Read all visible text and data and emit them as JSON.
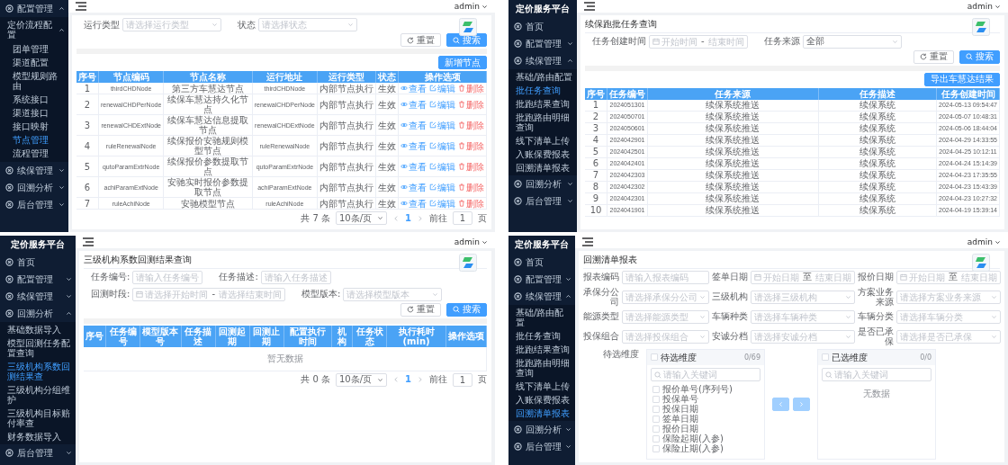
{
  "panels": [
    {
      "sidebar": {
        "items": [
          {
            "label": "配置管理",
            "selected": false,
            "expanded": true,
            "children": [
              {
                "label": "定价流程配置",
                "selected": false,
                "expanded": true,
                "children": [
                  {
                    "label": "团单管理",
                    "selected": false
                  },
                  {
                    "label": "渠道配置",
                    "selected": false
                  },
                  {
                    "label": "模型规则路由",
                    "selected": false
                  },
                  {
                    "label": "系统接口",
                    "selected": false
                  },
                  {
                    "label": "渠道接口",
                    "selected": false
                  },
                  {
                    "label": "接口映射",
                    "selected": false
                  },
                  {
                    "label": "节点管理",
                    "selected": true
                  },
                  {
                    "label": "流程管理",
                    "selected": false
                  }
                ]
              }
            ]
          },
          {
            "label": "续保管理",
            "selected": false,
            "expanded": false
          },
          {
            "label": "回溯分析",
            "selected": false,
            "expanded": false
          },
          {
            "label": "后台管理",
            "selected": false,
            "expanded": false
          }
        ]
      },
      "header": {
        "user": "admin"
      },
      "blocks": [
        {
          "kind": "filters",
          "fields": [
            {
              "label": "运行类型",
              "kind": "select",
              "placeholder": "请选择运行类型"
            },
            {
              "label": "状态",
              "kind": "select",
              "placeholder": "请选择状态"
            }
          ]
        },
        {
          "kind": "buttons",
          "items": [
            {
              "kind": "reset",
              "label": "重置"
            },
            {
              "kind": "search",
              "label": "搜索"
            }
          ]
        },
        {
          "kind": "bar"
        },
        {
          "kind": "toolbar",
          "button": "新增节点"
        },
        {
          "kind": "table",
          "columns": [
            {
              "label": "序号",
              "kind": "index"
            },
            {
              "label": "节点编码",
              "kind": "code"
            },
            {
              "label": "节点名称",
              "kind": "text"
            },
            {
              "label": "运行地址",
              "kind": "code"
            },
            {
              "label": "运行类型",
              "kind": "label"
            },
            {
              "label": "状态",
              "kind": "label"
            },
            {
              "label": "操作选项",
              "kind": "actions"
            }
          ],
          "rows": [
            {
              "cells": [
                "1",
                "thirdCHDNode",
                "第三方车慧达节点",
                "thirdCHDNode",
                "内部节点执行",
                "生效"
              ],
              "actions": [
                {
                  "kind": "view",
                  "label": "查看"
                },
                {
                  "kind": "edit",
                  "label": "编辑"
                },
                {
                  "kind": "delete",
                  "label": "删除"
                }
              ]
            },
            {
              "cells": [
                "2",
                "renewalCHDPerNode",
                "续保车慧达持久化节点",
                "renewalCHDPerNode",
                "内部节点执行",
                "生效"
              ],
              "actions": [
                {
                  "kind": "view",
                  "label": "查看"
                },
                {
                  "kind": "edit",
                  "label": "编辑"
                },
                {
                  "kind": "delete",
                  "label": "删除"
                }
              ]
            },
            {
              "cells": [
                "3",
                "renewalCHDExtNode",
                "续保车慧达信息提取节点",
                "renewalCHDExtNode",
                "内部节点执行",
                "生效"
              ],
              "actions": [
                {
                  "kind": "view",
                  "label": "查看"
                },
                {
                  "kind": "edit",
                  "label": "编辑"
                },
                {
                  "kind": "delete",
                  "label": "删除"
                }
              ]
            },
            {
              "cells": [
                "4",
                "ruleRenewalNode",
                "续保报价安驰规则模型节点",
                "ruleRenewalNode",
                "内部节点执行",
                "生效"
              ],
              "actions": [
                {
                  "kind": "view",
                  "label": "查看"
                },
                {
                  "kind": "edit",
                  "label": "编辑"
                },
                {
                  "kind": "delete",
                  "label": "删除"
                }
              ]
            },
            {
              "cells": [
                "5",
                "qutoParamExtrNode",
                "续保报价参数提取节点",
                "qutoParamExtrNode",
                "内部节点执行",
                "生效"
              ],
              "actions": [
                {
                  "kind": "view",
                  "label": "查看"
                },
                {
                  "kind": "edit",
                  "label": "编辑"
                },
                {
                  "kind": "delete",
                  "label": "删除"
                }
              ]
            },
            {
              "cells": [
                "6",
                "achiParamExtNode",
                "安驰实时报价参数提取节点",
                "achiParamExtNode",
                "内部节点执行",
                "生效"
              ],
              "actions": [
                {
                  "kind": "view",
                  "label": "查看"
                },
                {
                  "kind": "edit",
                  "label": "编辑"
                },
                {
                  "kind": "delete",
                  "label": "删除"
                }
              ]
            },
            {
              "cells": [
                "7",
                "ruleAchiNode",
                "安驰模型节点",
                "ruleAchiNode",
                "内部节点执行",
                "生效"
              ],
              "actions": [
                {
                  "kind": "view",
                  "label": "查看"
                },
                {
                  "kind": "edit",
                  "label": "编辑"
                },
                {
                  "kind": "delete",
                  "label": "删除"
                }
              ]
            }
          ]
        },
        {
          "kind": "pagination",
          "total": "共 7 条",
          "page_size": "10条/页",
          "pages": [
            {
              "label": "1",
              "selected": true
            }
          ],
          "goto_label": "前往",
          "goto_value": "1",
          "suffix": "页"
        }
      ]
    },
    {
      "sidebar": {
        "title": "定价服务平台",
        "items": [
          {
            "label": "首页",
            "selected": false
          },
          {
            "label": "配置管理",
            "selected": false,
            "expanded": false
          },
          {
            "label": "续保管理",
            "selected": false,
            "expanded": true,
            "children": [
              {
                "label": "基础/路由配置",
                "selected": false
              },
              {
                "label": "批任务查询",
                "selected": true
              },
              {
                "label": "批跑结果查询",
                "selected": false
              },
              {
                "label": "批跑路由明细查询",
                "selected": false
              },
              {
                "label": "线下清单上传",
                "selected": false
              },
              {
                "label": "入账保费报表",
                "selected": false
              },
              {
                "label": "回溯清单报表",
                "selected": false
              }
            ]
          },
          {
            "label": "回溯分析",
            "selected": false,
            "expanded": false
          },
          {
            "label": "后台管理",
            "selected": false,
            "expanded": false
          }
        ]
      },
      "header": {
        "user": "admin"
      },
      "blocks": [
        {
          "kind": "title",
          "text": "续保跑批任务查询"
        },
        {
          "kind": "filters",
          "fields": [
            {
              "label": "任务创建时间",
              "kind": "daterange",
              "start_placeholder": "开始时间",
              "separator": "-",
              "end_placeholder": "结束时间"
            },
            {
              "label": "任务来源",
              "kind": "select",
              "value": "全部"
            }
          ]
        },
        {
          "kind": "buttons",
          "items": [
            {
              "kind": "reset",
              "label": "重置"
            },
            {
              "kind": "search",
              "label": "搜索"
            }
          ]
        },
        {
          "kind": "bar"
        },
        {
          "kind": "toolbar",
          "button": "导出车慧达结果"
        },
        {
          "kind": "table",
          "columns": [
            {
              "label": "序号",
              "kind": "index"
            },
            {
              "label": "任务编号",
              "kind": "code"
            },
            {
              "label": "任务来源",
              "kind": "text"
            },
            {
              "label": "任务描述",
              "kind": "text"
            },
            {
              "label": "任务创建时间",
              "kind": "code"
            }
          ],
          "rows": [
            {
              "cells": [
                "1",
                "2024051301",
                "续保系统推送",
                "续保系统",
                "2024-05-13 09:54:47"
              ]
            },
            {
              "cells": [
                "2",
                "2024050701",
                "续保系统推送",
                "续保系统",
                "2024-05-07 10:48:31"
              ]
            },
            {
              "cells": [
                "3",
                "2024050601",
                "续保系统推送",
                "续保系统",
                "2024-05-06 18:44:04"
              ]
            },
            {
              "cells": [
                "4",
                "2024042901",
                "续保系统推送",
                "续保系统",
                "2024-04-29 14:33:55"
              ]
            },
            {
              "cells": [
                "5",
                "2024042501",
                "续保系统推送",
                "续保系统",
                "2024-04-25 10:12:11"
              ]
            },
            {
              "cells": [
                "6",
                "2024042401",
                "续保系统推送",
                "续保系统",
                "2024-04-24 15:14:39"
              ]
            },
            {
              "cells": [
                "7",
                "2024042303",
                "续保系统推送",
                "续保系统",
                "2024-04-23 17:35:55"
              ]
            },
            {
              "cells": [
                "8",
                "2024042302",
                "续保系统推送",
                "续保系统",
                "2024-04-23 15:43:39"
              ]
            },
            {
              "cells": [
                "9",
                "2024042301",
                "续保系统推送",
                "续保系统",
                "2024-04-23 10:27:32"
              ]
            },
            {
              "cells": [
                "10",
                "2024041901",
                "续保系统推送",
                "续保系统",
                "2024-04-19 15:39:14"
              ]
            }
          ]
        }
      ]
    },
    {
      "sidebar": {
        "title": "定价服务平台",
        "items": [
          {
            "label": "首页",
            "selected": false
          },
          {
            "label": "配置管理",
            "selected": false,
            "expanded": false
          },
          {
            "label": "续保管理",
            "selected": false,
            "expanded": false
          },
          {
            "label": "回溯分析",
            "selected": false,
            "expanded": true,
            "children": [
              {
                "label": "基础数据导入",
                "selected": false
              },
              {
                "label": "模型回测任务配置查询",
                "selected": false
              },
              {
                "label": "三级机构系数回测结果查",
                "selected": true
              },
              {
                "label": "三级机构分组维护",
                "selected": false
              },
              {
                "label": "三级机构目标赔付率查",
                "selected": false
              },
              {
                "label": "财务数据导入",
                "selected": false
              }
            ]
          },
          {
            "label": "后台管理",
            "selected": false,
            "expanded": false
          }
        ]
      },
      "header": {
        "user": "admin"
      },
      "blocks": [
        {
          "kind": "title",
          "text": "三级机构系数回测结果查询"
        },
        {
          "kind": "filters",
          "fields": [
            {
              "label": "任务编号:",
              "kind": "input",
              "placeholder": "请输入任务编号"
            },
            {
              "label": "任务描述:",
              "kind": "input",
              "placeholder": "请输入任务描述"
            },
            {
              "label": "回测时段:",
              "kind": "daterange",
              "start_placeholder": "请选择开始时间",
              "separator": "-",
              "end_placeholder": "请选择结束时间"
            },
            {
              "label": "模型版本:",
              "kind": "select",
              "placeholder": "请选择模型版本"
            }
          ]
        },
        {
          "kind": "buttons",
          "items": [
            {
              "kind": "reset",
              "label": "重置"
            },
            {
              "kind": "search",
              "label": "搜索"
            }
          ]
        },
        {
          "kind": "bar"
        },
        {
          "kind": "table",
          "columns": [
            {
              "label": "序号",
              "kind": "index"
            },
            {
              "label": "任务编号",
              "kind": "text"
            },
            {
              "label": "模型版本号",
              "kind": "text"
            },
            {
              "label": "任务描述",
              "kind": "text"
            },
            {
              "label": "回测起期",
              "kind": "text"
            },
            {
              "label": "回测止期",
              "kind": "text"
            },
            {
              "label": "配置执行时间",
              "kind": "text"
            },
            {
              "label": "机构",
              "kind": "text"
            },
            {
              "label": "任务状态",
              "kind": "text"
            },
            {
              "label": "执行耗时(min)",
              "kind": "text"
            },
            {
              "label": "操作选项",
              "kind": "actions"
            }
          ],
          "empty_text": "暂无数据"
        },
        {
          "kind": "pagination",
          "total": "共 0 条",
          "page_size": "10条/页",
          "pages": [
            {
              "label": "1",
              "selected": true
            }
          ],
          "goto_label": "前往",
          "goto_value": "1",
          "suffix": "页"
        }
      ]
    },
    {
      "sidebar": {
        "title": "定价服务平台",
        "items": [
          {
            "label": "首页",
            "selected": false
          },
          {
            "label": "配置管理",
            "selected": false,
            "expanded": false
          },
          {
            "label": "续保管理",
            "selected": false,
            "expanded": true,
            "children": [
              {
                "label": "基础/路由配置",
                "selected": false
              },
              {
                "label": "批任务查询",
                "selected": false
              },
              {
                "label": "批跑结果查询",
                "selected": false
              },
              {
                "label": "批跑路由明细查询",
                "selected": false
              },
              {
                "label": "线下清单上传",
                "selected": false
              },
              {
                "label": "入账保费报表",
                "selected": false
              },
              {
                "label": "回溯清单报表",
                "selected": true
              }
            ]
          },
          {
            "label": "回溯分析",
            "selected": false,
            "expanded": false
          },
          {
            "label": "后台管理",
            "selected": false,
            "expanded": false
          }
        ]
      },
      "header": {
        "user": "admin"
      },
      "blocks": [
        {
          "kind": "title",
          "text": "回溯清单报表"
        },
        {
          "kind": "form",
          "fields": [
            {
              "label": "报表编码",
              "kind": "input",
              "placeholder": "请输入报表编码"
            },
            {
              "label": "签单日期",
              "kind": "daterange",
              "start_placeholder": "开始日期",
              "separator": "至",
              "end_placeholder": "结束日期"
            },
            {
              "label": "报价日期",
              "kind": "daterange",
              "start_placeholder": "开始日期",
              "separator": "至",
              "end_placeholder": "结束日期"
            },
            {
              "label": "承保分公司",
              "kind": "select",
              "placeholder": "请选择承保分公司"
            },
            {
              "label": "三级机构",
              "kind": "select",
              "placeholder": "请选择三级机构"
            },
            {
              "label": "方案业务来源",
              "kind": "select",
              "placeholder": "请选择方案业务来源"
            },
            {
              "label": "能源类型",
              "kind": "select",
              "placeholder": "请选择能源类型"
            },
            {
              "label": "车辆种类",
              "kind": "select",
              "placeholder": "请选择车辆种类"
            },
            {
              "label": "车辆分类",
              "kind": "select",
              "placeholder": "请选择车辆分类"
            },
            {
              "label": "投保组合",
              "kind": "select",
              "placeholder": "请选择投保组合"
            },
            {
              "label": "安诚分档",
              "kind": "select",
              "placeholder": "请选择安诚分档"
            },
            {
              "label": "是否已承保",
              "kind": "select",
              "placeholder": "请选择是否已承保"
            }
          ]
        },
        {
          "kind": "transfer",
          "label": "待选维度",
          "lists": [
            {
              "title": "待选维度",
              "checked": false,
              "count": "0/69",
              "search_placeholder": "请输入关键词",
              "items": [
                {
                  "label": "报价单号(序列号)",
                  "checked": false
                },
                {
                  "label": "投保单号",
                  "checked": false
                },
                {
                  "label": "投保日期",
                  "checked": false
                },
                {
                  "label": "签单日期",
                  "checked": false
                },
                {
                  "label": "报价日期",
                  "checked": false
                },
                {
                  "label": "保险起期(入参)",
                  "checked": false
                },
                {
                  "label": "保险止期(入参)",
                  "checked": false
                }
              ]
            },
            {
              "title": "已选维度",
              "checked": false,
              "count": "0/0",
              "search_placeholder": "请输入关键词",
              "empty_text": "无数据"
            }
          ],
          "buttons": [
            {
              "kind": "left",
              "disabled": true
            },
            {
              "kind": "right",
              "disabled": true
            }
          ]
        }
      ]
    }
  ]
}
